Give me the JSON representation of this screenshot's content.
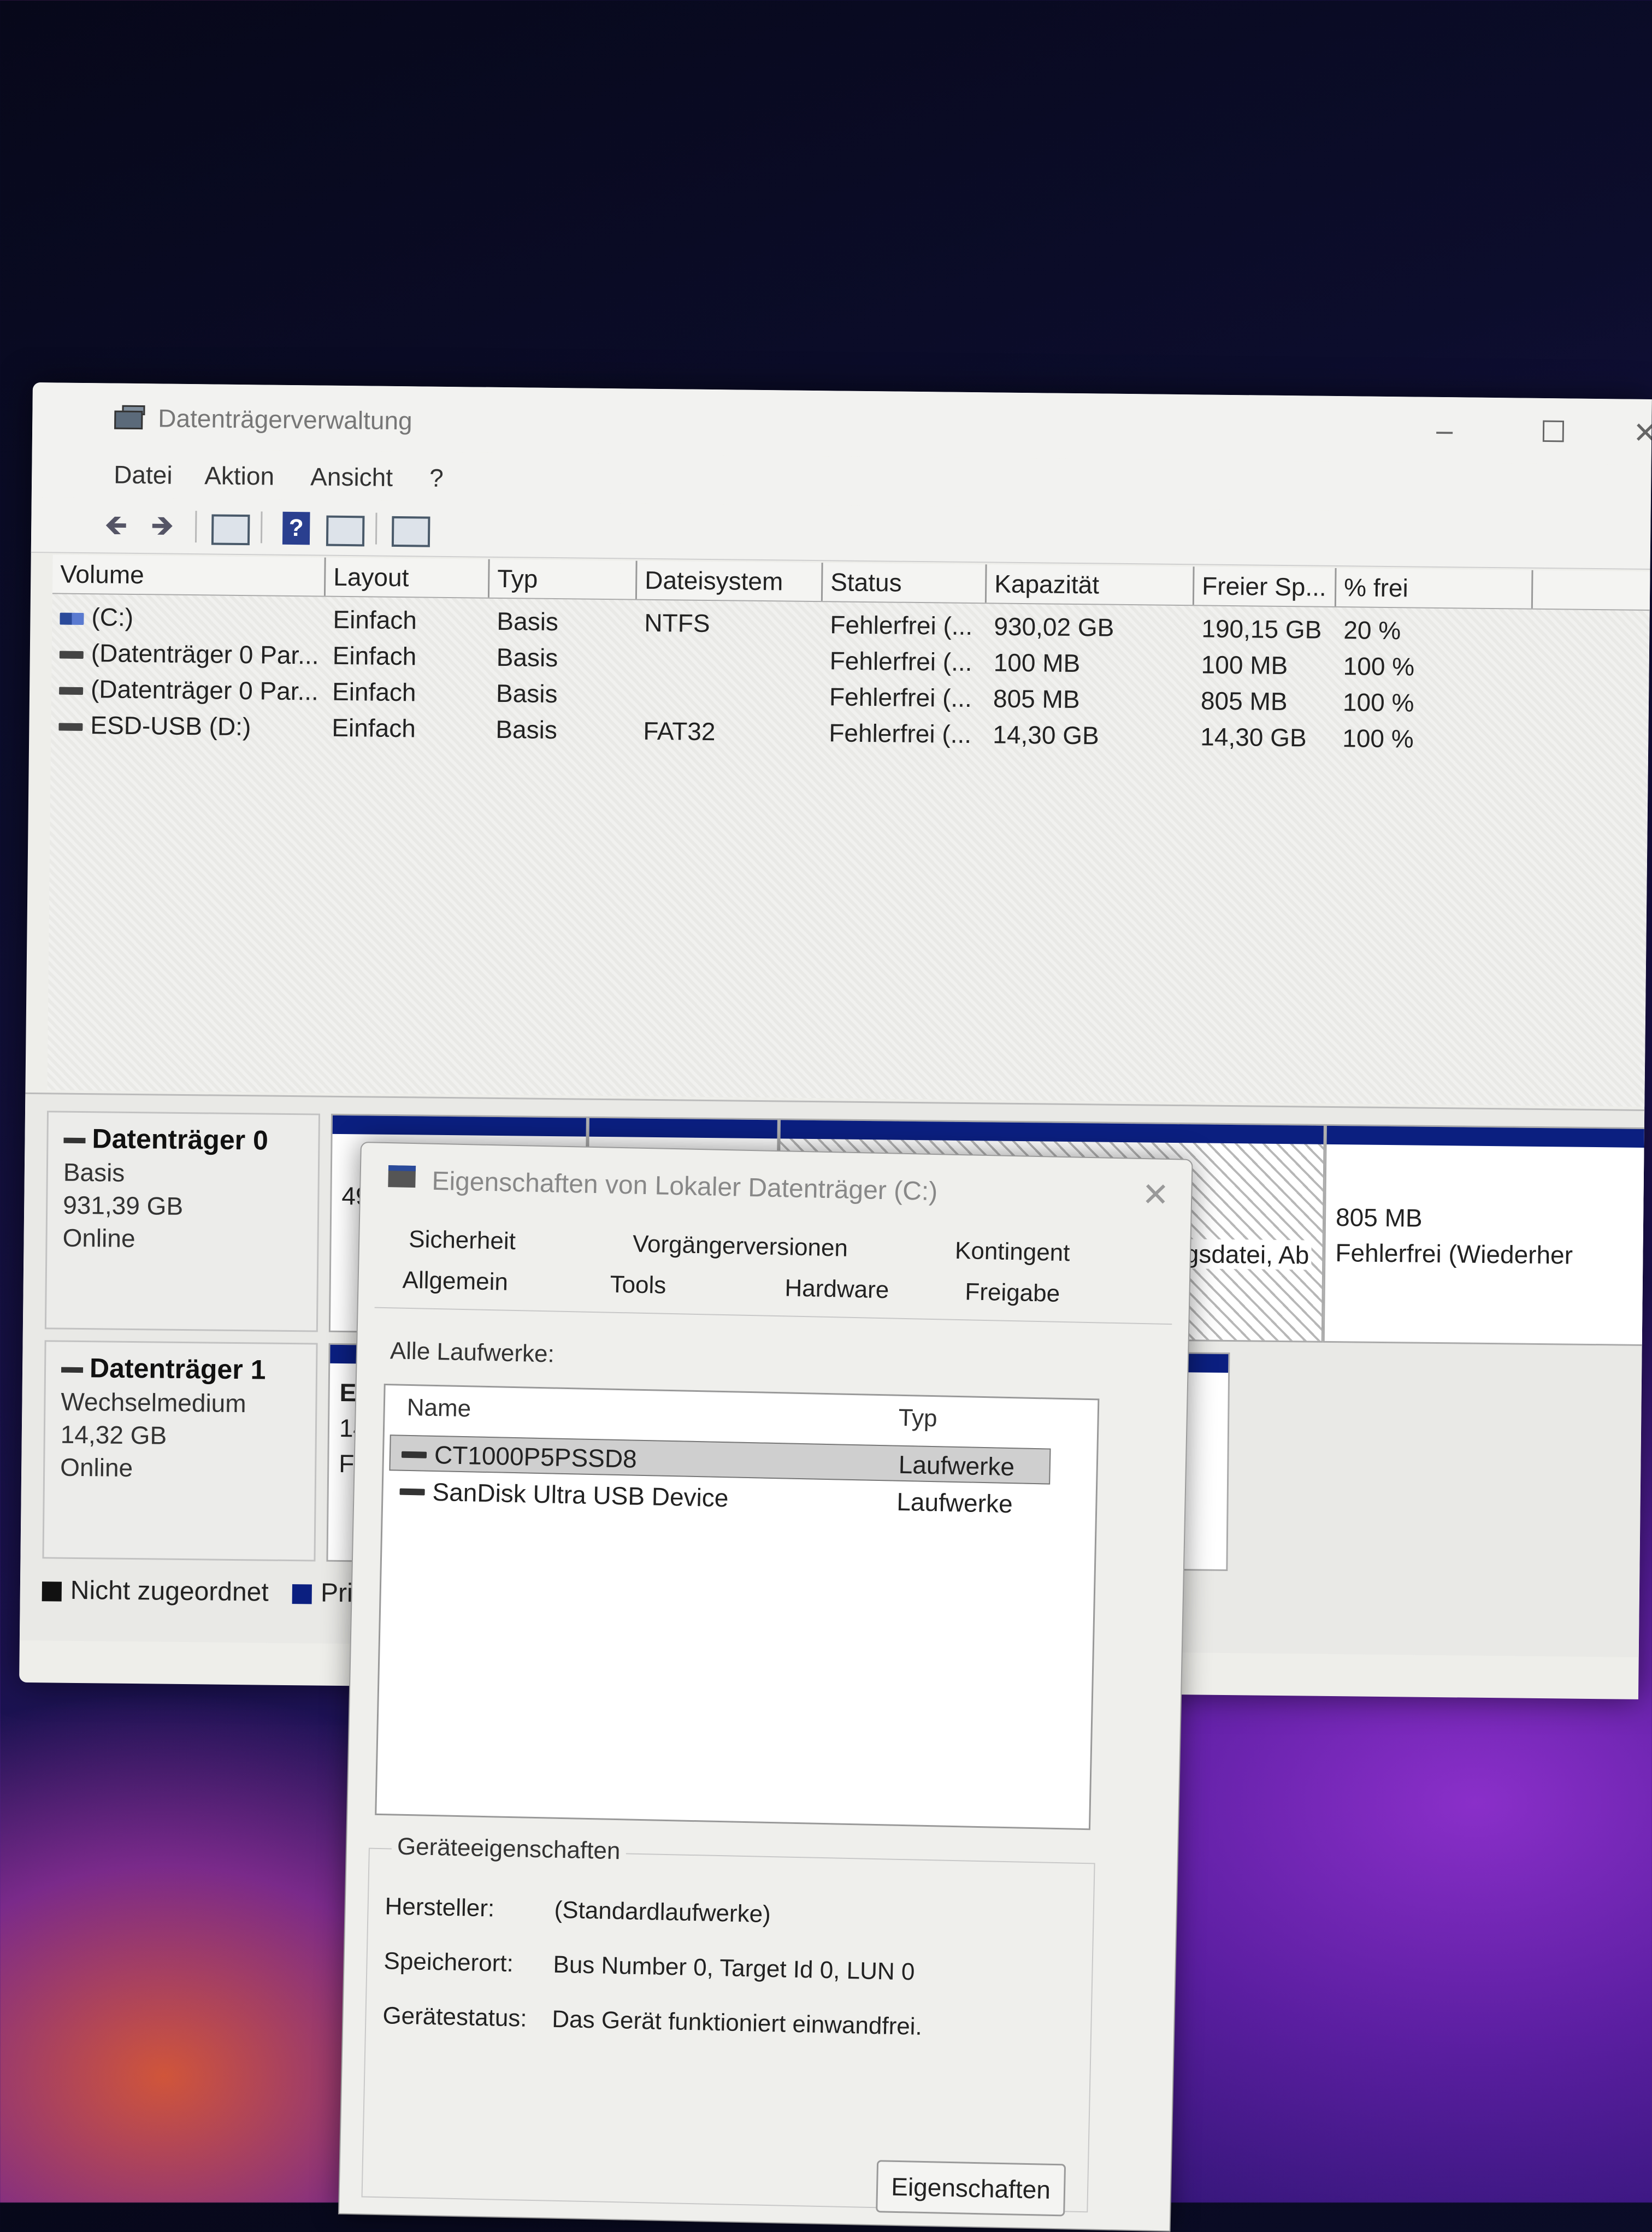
{
  "window": {
    "title": "Datenträgerverwaltung",
    "menu": [
      "Datei",
      "Aktion",
      "Ansicht",
      "?"
    ],
    "controls": {
      "minimize": "–",
      "maximize": "☐",
      "close": "✕"
    }
  },
  "toolbar": {
    "icons": [
      "back-arrow-icon",
      "forward-arrow-icon",
      "console-tree-icon",
      "help-icon",
      "action-pane-icon",
      "properties-icon"
    ],
    "back": "🡸",
    "forward": "🡺",
    "help": "?"
  },
  "volume_table": {
    "headers": [
      "Volume",
      "Layout",
      "Typ",
      "Dateisystem",
      "Status",
      "Kapazität",
      "Freier Sp...",
      "% frei"
    ],
    "rows": [
      {
        "volume": "(C:)",
        "layout": "Einfach",
        "typ": "Basis",
        "dateisystem": "NTFS",
        "status": "Fehlerfrei (...",
        "kapazitaet": "930,02 GB",
        "frei": "190,15 GB",
        "prozent": "20 %"
      },
      {
        "volume": "(Datenträger 0 Par...",
        "layout": "Einfach",
        "typ": "Basis",
        "dateisystem": "",
        "status": "Fehlerfrei (...",
        "kapazitaet": "100 MB",
        "frei": "100 MB",
        "prozent": "100 %"
      },
      {
        "volume": "(Datenträger 0 Par...",
        "layout": "Einfach",
        "typ": "Basis",
        "dateisystem": "",
        "status": "Fehlerfrei (...",
        "kapazitaet": "805 MB",
        "frei": "805 MB",
        "prozent": "100 %"
      },
      {
        "volume": "ESD-USB (D:)",
        "layout": "Einfach",
        "typ": "Basis",
        "dateisystem": "FAT32",
        "status": "Fehlerfrei (...",
        "kapazitaet": "14,30 GB",
        "frei": "14,30 GB",
        "prozent": "100 %"
      }
    ]
  },
  "disks": [
    {
      "name": "Datenträger 0",
      "type": "Basis",
      "size": "931,39 GB",
      "state": "Online",
      "partition_fragment": "499",
      "right_partition_fragment": "erungsdatei, Ab",
      "recovery_size": "805 MB",
      "recovery_status": "Fehlerfrei (Wiederher"
    },
    {
      "name": "Datenträger 1",
      "type": "Wechselmedium",
      "size": "14,32 GB",
      "state": "Online",
      "partition_line1": "ESD",
      "partition_line2": "14,3",
      "partition_line3": "Feh"
    }
  ],
  "legend": {
    "unallocated": "Nicht zugeordnet",
    "primary": "Pri"
  },
  "colors": {
    "unallocated": "#111111",
    "primary": "#0b1f80"
  },
  "dialog": {
    "title": "Eigenschaften von Lokaler Datenträger (C:)",
    "close": "✕",
    "tabs_row1": [
      "Sicherheit",
      "Vorgängerversionen",
      "Kontingent"
    ],
    "tabs_row2": [
      "Allgemein",
      "Tools",
      "Hardware",
      "Freigabe"
    ],
    "all_drives_label": "Alle Laufwerke:",
    "list_headers": {
      "name": "Name",
      "type": "Typ"
    },
    "drives": [
      {
        "name": "CT1000P5PSSD8",
        "type": "Laufwerke",
        "selected": true
      },
      {
        "name": "SanDisk Ultra USB Device",
        "type": "Laufwerke",
        "selected": false
      }
    ],
    "device_props": {
      "title": "Geräteeigenschaften",
      "manufacturer_label": "Hersteller:",
      "manufacturer": "(Standardlaufwerke)",
      "location_label": "Speicherort:",
      "location": "Bus Number 0, Target Id 0, LUN 0",
      "status_label": "Gerätestatus:",
      "status": "Das Gerät funktioniert einwandfrei."
    },
    "properties_button": "Eigenschaften"
  }
}
